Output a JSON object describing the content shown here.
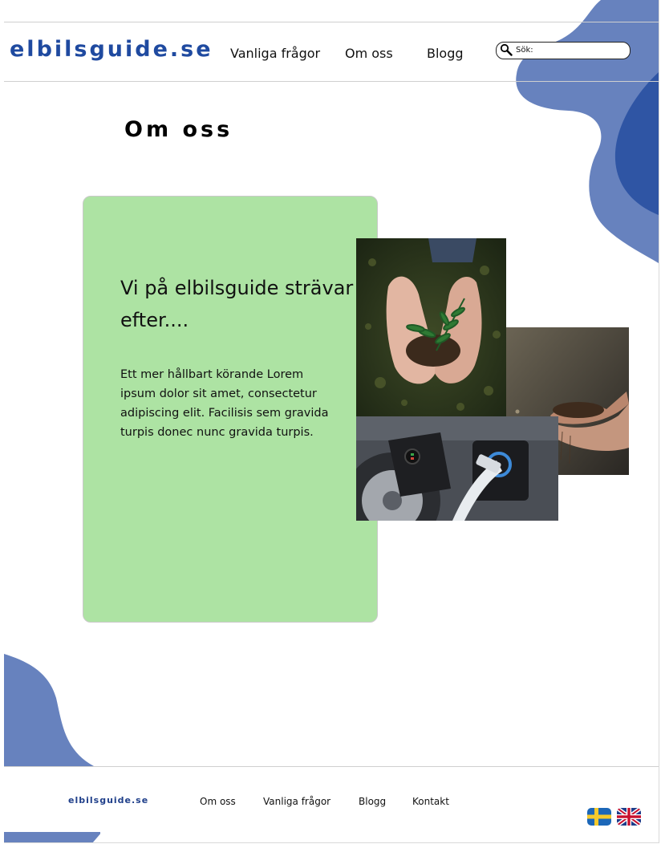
{
  "header": {
    "logo": "elbilsguide.se",
    "nav": [
      {
        "label": "Vanliga frågor"
      },
      {
        "label": "Om oss"
      },
      {
        "label": "Blogg"
      }
    ],
    "search": {
      "placeholder": "Sök:",
      "icon": "magnifier-icon"
    }
  },
  "main": {
    "title": "Om oss",
    "card": {
      "heading": "Vi på elbilsguide strävar efter....",
      "body": "Ett mer hållbart körande Lorem ipsum dolor sit amet, consectetur adipiscing elit. Facilisis sem gravida turpis donec nunc gravida turpis."
    },
    "images": [
      "hands-holding-plant-photo",
      "hands-holding-soil-photo",
      "ev-charging-photo"
    ]
  },
  "footer": {
    "logo": "elbilsguide.se",
    "links": [
      {
        "label": "Om oss"
      },
      {
        "label": "Vanliga frågor"
      },
      {
        "label": "Blogg"
      },
      {
        "label": "Kontakt"
      }
    ],
    "languages": [
      "swedish-flag-icon",
      "uk-flag-icon"
    ]
  },
  "colors": {
    "brand_blue": "#1f4aa0",
    "blob_blue_light": "#6782be",
    "blob_blue_dark": "#2f55a4",
    "card_green": "#ade3a3"
  }
}
